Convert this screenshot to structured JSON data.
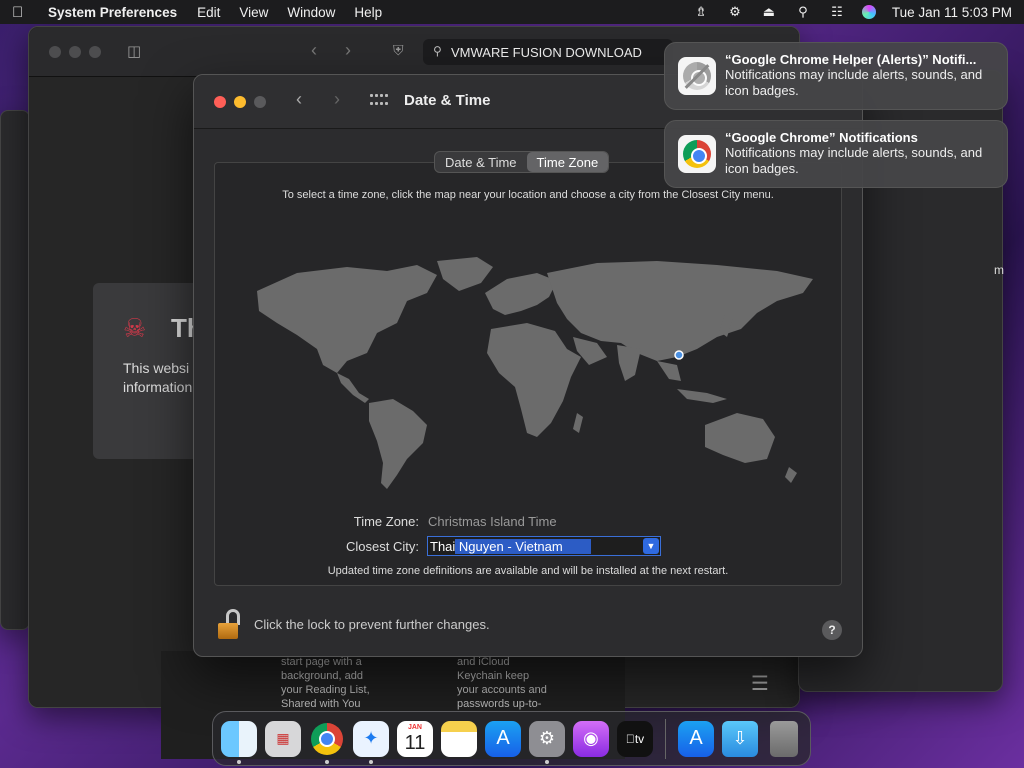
{
  "menubar": {
    "app_name": "System Preferences",
    "menus": [
      "Edit",
      "View",
      "Window",
      "Help"
    ],
    "datetime": "Tue Jan 11  5:03 PM"
  },
  "safari": {
    "url_text": "VMWARE FUSION DOWNLOAD",
    "error_title": "Th",
    "error_line1": "This websi",
    "error_line2": "information",
    "reading_list_text": [
      "start page with a",
      "background, add",
      "your Reading List,",
      "Shared with You"
    ],
    "keychain_text": [
      "and iCloud",
      "Keychain keep",
      "your accounts and",
      "passwords up-to-"
    ]
  },
  "right_window": {
    "stub_text": "m"
  },
  "prefs": {
    "title": "Date & Time",
    "tabs": [
      {
        "label": "Date & Time",
        "active": false
      },
      {
        "label": "Time Zone",
        "active": true
      }
    ],
    "instructions": "To select a time zone, click the map near your location and choose a city from the Closest City menu.",
    "time_zone_label": "Time Zone:",
    "time_zone_value": "Christmas Island Time",
    "closest_city_label": "Closest City:",
    "closest_city_typed": "Thai",
    "closest_city_completion": " Nguyen - Vietnam",
    "update_note": "Updated time zone definitions are available and will be installed at the next restart.",
    "lock_text": "Click the lock to prevent further changes.",
    "help_label": "?"
  },
  "notifications": [
    {
      "title": "“Google Chrome Helper (Alerts)” Notifi...",
      "body": "Notifications may include alerts, sounds, and icon badges.",
      "icon": "chrome-helper-disabled-icon"
    },
    {
      "title": "“Google Chrome” Notifications",
      "body": "Notifications may include alerts, sounds, and icon badges.",
      "icon": "chrome-icon"
    }
  ],
  "dock": {
    "calendar_month": "JAN",
    "calendar_day": "11",
    "tv_label": "tv"
  },
  "colors": {
    "accent": "#2f6ae0",
    "close": "#ff5f57",
    "minimize": "#febc2e",
    "map_land": "#6b6b6b",
    "location_dot": "#4a90e2"
  }
}
